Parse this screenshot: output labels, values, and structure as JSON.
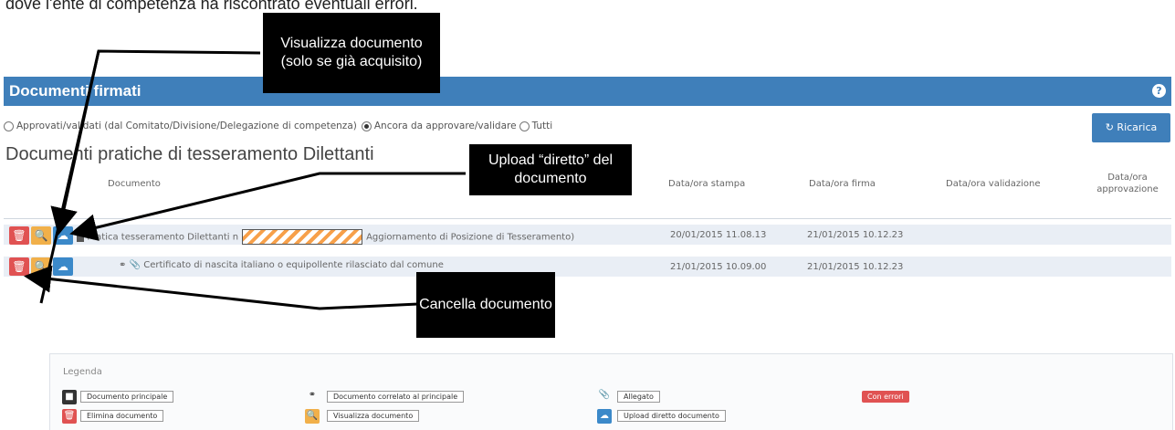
{
  "intro_text": "dove l'ente di competenza ha riscontrato eventuali errori.",
  "header": {
    "title": "Documenti firmati",
    "help_icon": "?"
  },
  "filters": {
    "options": [
      {
        "label": "Approvati/validati (dal Comitato/Divisione/Delegazione di competenza)",
        "selected": false
      },
      {
        "label": "Ancora da approvare/validare",
        "selected": true
      },
      {
        "label": "Tutti",
        "selected": false
      }
    ]
  },
  "reload_button": {
    "icon": "↻",
    "label": "Ricarica"
  },
  "section_title": "Documenti pratiche di tesseramento Dilettanti",
  "table": {
    "columns": [
      "Documento",
      "Data/ora stampa",
      "Data/ora firma",
      "Data/ora validazione",
      "Data/ora approvazione"
    ],
    "rows": [
      {
        "doc_prefix": "Pratica tesseramento Dilettanti n",
        "doc_suffix": "Aggiornamento di Posizione di Tesseramento)",
        "stampa": "20/01/2015 11.08.13",
        "firma": "21/01/2015 10.12.23",
        "validazione": "",
        "approvazione": ""
      },
      {
        "doc": "Certificato di nascita italiano o equipollente rilasciato dal comune",
        "stampa": "21/01/2015 10.09.00",
        "firma": "21/01/2015 10.12.23",
        "validazione": "",
        "approvazione": ""
      }
    ]
  },
  "callouts": {
    "view": "Visualizza documento (solo se già acquisito)",
    "upload": "Upload “diretto” del documento",
    "delete": "Cancella documento"
  },
  "legend": {
    "title": "Legenda",
    "main_doc": "Documento principale",
    "delete_doc": "Elimina documento",
    "related_doc": "Documento correlato al principale",
    "view_doc": "Visualizza documento",
    "attachment": "Allegato",
    "upload_doc": "Upload diretto documento",
    "errors": "Con errori"
  },
  "colors": {
    "header": "#3f7fba",
    "delete": "#e05252",
    "view": "#f1b04a",
    "upload": "#3b89c9"
  }
}
